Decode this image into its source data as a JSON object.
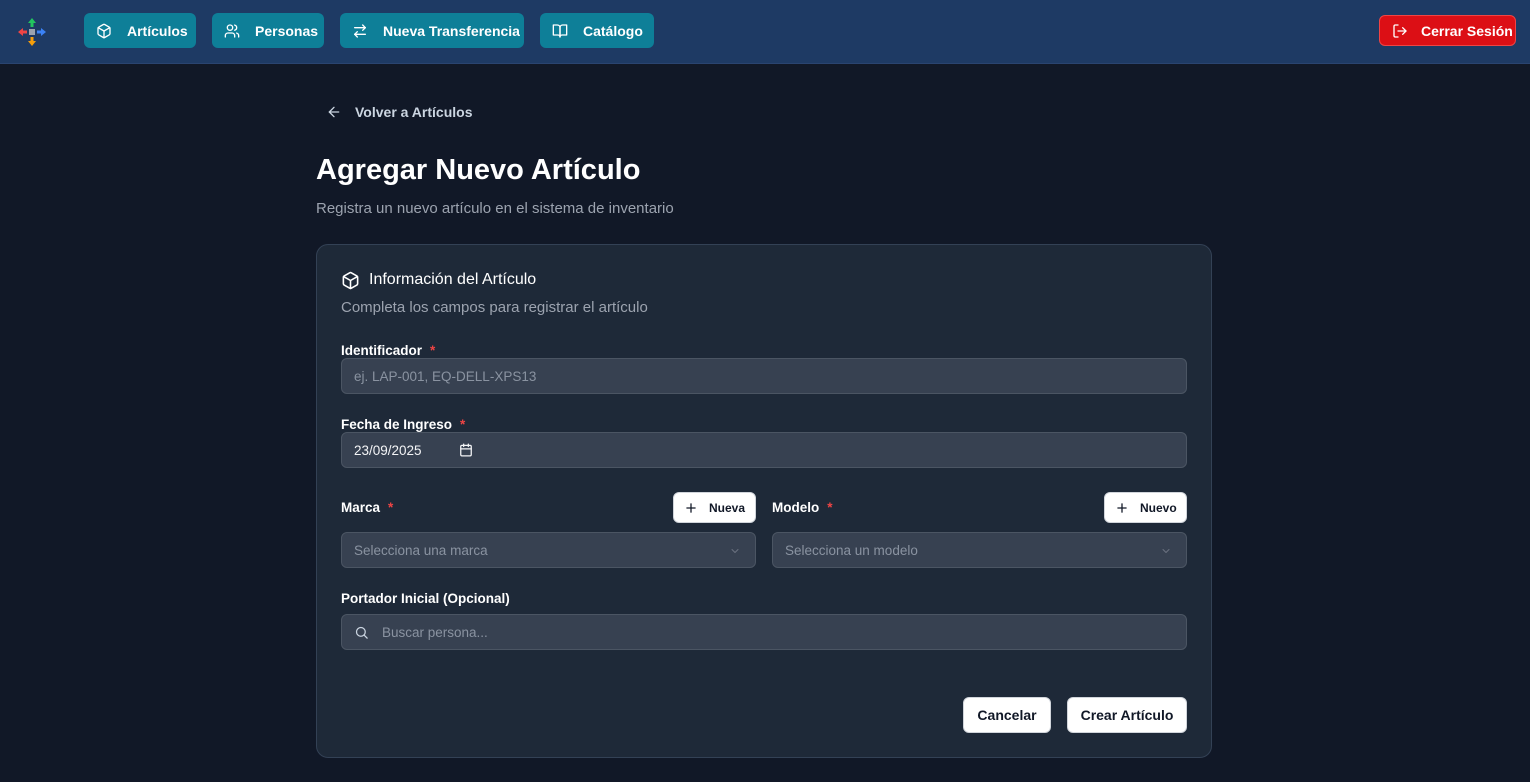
{
  "nav": {
    "items": [
      {
        "label": "Artículos",
        "icon": "box-icon"
      },
      {
        "label": "Personas",
        "icon": "users-icon"
      },
      {
        "label": "Nueva Transferencia",
        "icon": "transfer-icon"
      },
      {
        "label": "Catálogo",
        "icon": "book-icon"
      }
    ],
    "logout_label": "Cerrar Sesión",
    "logout_icon": "logout-icon"
  },
  "page": {
    "back_label": "Volver a Artículos",
    "title": "Agregar Nuevo Artículo",
    "subtitle": "Registra un nuevo artículo en el sistema de inventario"
  },
  "form": {
    "title": "Información del Artículo",
    "description": "Completa los campos para registrar el artículo",
    "required_mark": "*",
    "identifier": {
      "label": "Identificador",
      "placeholder": "ej. LAP-001, EQ-DELL-XPS13"
    },
    "entry_date": {
      "label": "Fecha de Ingreso",
      "value": "23/09/2025"
    },
    "brand": {
      "label": "Marca",
      "placeholder": "Selecciona una marca",
      "new_label": "Nueva"
    },
    "model": {
      "label": "Modelo",
      "placeholder": "Selecciona un modelo",
      "new_label": "Nuevo"
    },
    "holder": {
      "label": "Portador Inicial (Opcional)",
      "placeholder": "Buscar persona..."
    },
    "cancel_label": "Cancelar",
    "submit_label": "Crear Artículo"
  },
  "colors": {
    "nav_bg": "#1e3a64",
    "nav_button": "#0e7f98",
    "logout": "#dc0f15",
    "page_bg": "#111827",
    "card_bg": "#1e2938",
    "required": "#ef4444"
  }
}
